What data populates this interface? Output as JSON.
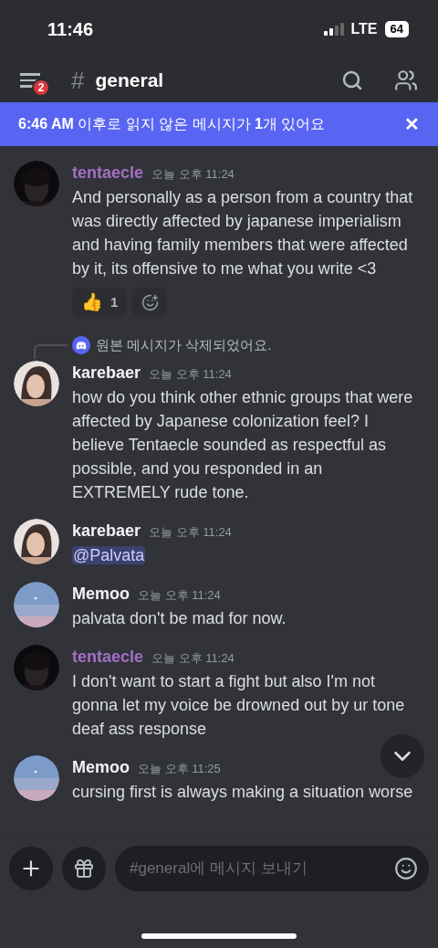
{
  "status_bar": {
    "time": "11:46",
    "network": "LTE",
    "battery": "64"
  },
  "header": {
    "menu_badge": "2",
    "channel_hash": "#",
    "channel": "general"
  },
  "banner": {
    "text": "**6:46 AM** 이후로 읽지 않은 메시지가 **1**개 있어요",
    "close": "✕"
  },
  "messages": [
    {
      "author": "tentaecle",
      "color": "#a36fc4",
      "time": "오늘 오후 11:24",
      "text": "And personally as a person from a country that was directly affected by japanese imperialism and having family members that were affected by it, its offensive to me what you write <3",
      "reactions": [
        {
          "emoji": "👍",
          "count": "1"
        }
      ]
    },
    {
      "author": "karebaer",
      "color": "#f2f3f5",
      "time": "오늘 오후 11:24",
      "reply": "원본 메시지가 삭제되었어요.",
      "text": "how do you think other ethnic groups that were affected by Japanese colonization feel? I believe Tentaecle sounded as respectful as possible, and you responded in an EXTREMELY rude tone."
    },
    {
      "author": "karebaer",
      "color": "#f2f3f5",
      "time": "오늘 오후 11:24",
      "mention": "@Palvata"
    },
    {
      "author": "Memoo",
      "color": "#f2f3f5",
      "time": "오늘 오후 11:24",
      "text": "palvata don't be mad for now."
    },
    {
      "author": "tentaecle",
      "color": "#a36fc4",
      "time": "오늘 오후 11:24",
      "text": "I don't want to start a fight but also I'm not gonna let my voice be drowned out by ur tone deaf ass response"
    },
    {
      "author": "Memoo",
      "color": "#f2f3f5",
      "time": "오늘 오후 11:25",
      "text": "cursing first is always making a situation worse"
    }
  ],
  "composer": {
    "placeholder": "#general에 메시지 보내기"
  }
}
